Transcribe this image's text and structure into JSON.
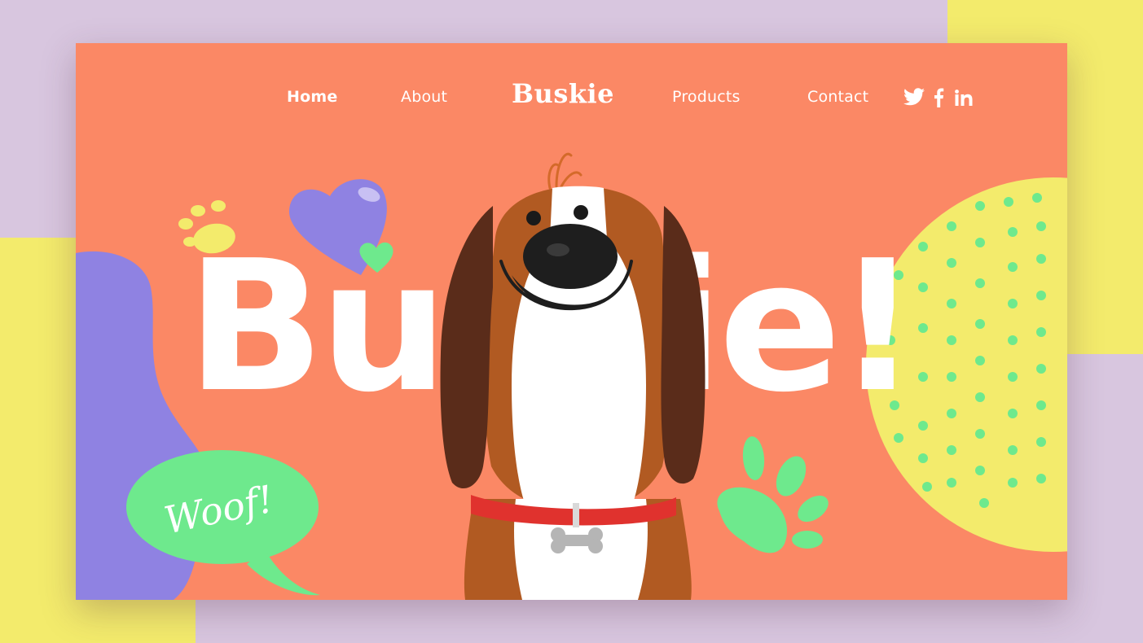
{
  "nav": {
    "items": [
      {
        "label": "Home",
        "active": true
      },
      {
        "label": "About",
        "active": false
      },
      {
        "label": "Products",
        "active": false
      },
      {
        "label": "Contact",
        "active": false
      }
    ],
    "logo": "Buskie",
    "social_icons": [
      "twitter-icon",
      "facebook-icon",
      "linkedin-icon"
    ]
  },
  "hero": {
    "title": "Buskie!",
    "speech_bubble": "Woof!"
  },
  "colors": {
    "background": "#d8c6df",
    "accent_yellow": "#f3eb6c",
    "card": "#fb8865",
    "purple": "#8f82e2",
    "green": "#6ee98d",
    "white": "#ffffff"
  }
}
